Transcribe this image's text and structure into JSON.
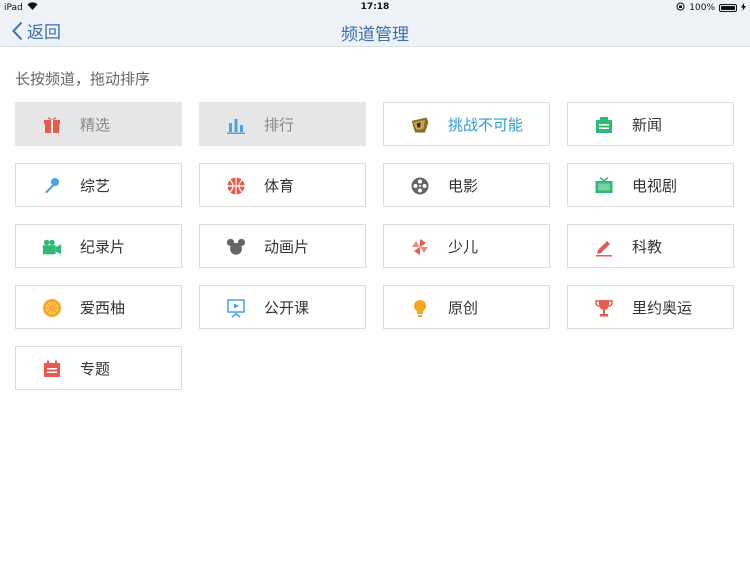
{
  "status_bar": {
    "device": "iPad",
    "time": "17:18",
    "battery": "100%"
  },
  "nav": {
    "back_label": "返回",
    "title": "频道管理"
  },
  "hint": "长按频道，拖动排序",
  "channels": [
    {
      "label": "精选",
      "icon": "gift-icon",
      "color": "#e95a4e",
      "pinned": true
    },
    {
      "label": "排行",
      "icon": "bar-chart-icon",
      "color": "#4aa3e8",
      "pinned": true
    },
    {
      "label": "挑战不可能",
      "icon": "challenge-logo-icon",
      "color": "#8a6d2a",
      "highlight": true
    },
    {
      "label": "新闻",
      "icon": "newspaper-icon",
      "color": "#2dbb74"
    },
    {
      "label": "综艺",
      "icon": "microphone-icon",
      "color": "#4aa3e8"
    },
    {
      "label": "体育",
      "icon": "basketball-icon",
      "color": "#e95a4e"
    },
    {
      "label": "电影",
      "icon": "film-reel-icon",
      "color": "#666666"
    },
    {
      "label": "电视剧",
      "icon": "tv-icon",
      "color": "#2dbb74"
    },
    {
      "label": "纪录片",
      "icon": "video-camera-icon",
      "color": "#2dbb74"
    },
    {
      "label": "动画片",
      "icon": "mouse-ears-icon",
      "color": "#666666"
    },
    {
      "label": "少儿",
      "icon": "pinwheel-icon",
      "color": "#e95a4e"
    },
    {
      "label": "科教",
      "icon": "pencil-icon",
      "color": "#e95a4e"
    },
    {
      "label": "爱西柚",
      "icon": "orange-slice-icon",
      "color": "#f5a623"
    },
    {
      "label": "公开课",
      "icon": "presentation-board-icon",
      "color": "#4aa3e8"
    },
    {
      "label": "原创",
      "icon": "lightbulb-icon",
      "color": "#f5a623"
    },
    {
      "label": "里约奥运",
      "icon": "trophy-icon",
      "color": "#e95a4e"
    },
    {
      "label": "专题",
      "icon": "calendar-icon",
      "color": "#e95a4e"
    }
  ]
}
